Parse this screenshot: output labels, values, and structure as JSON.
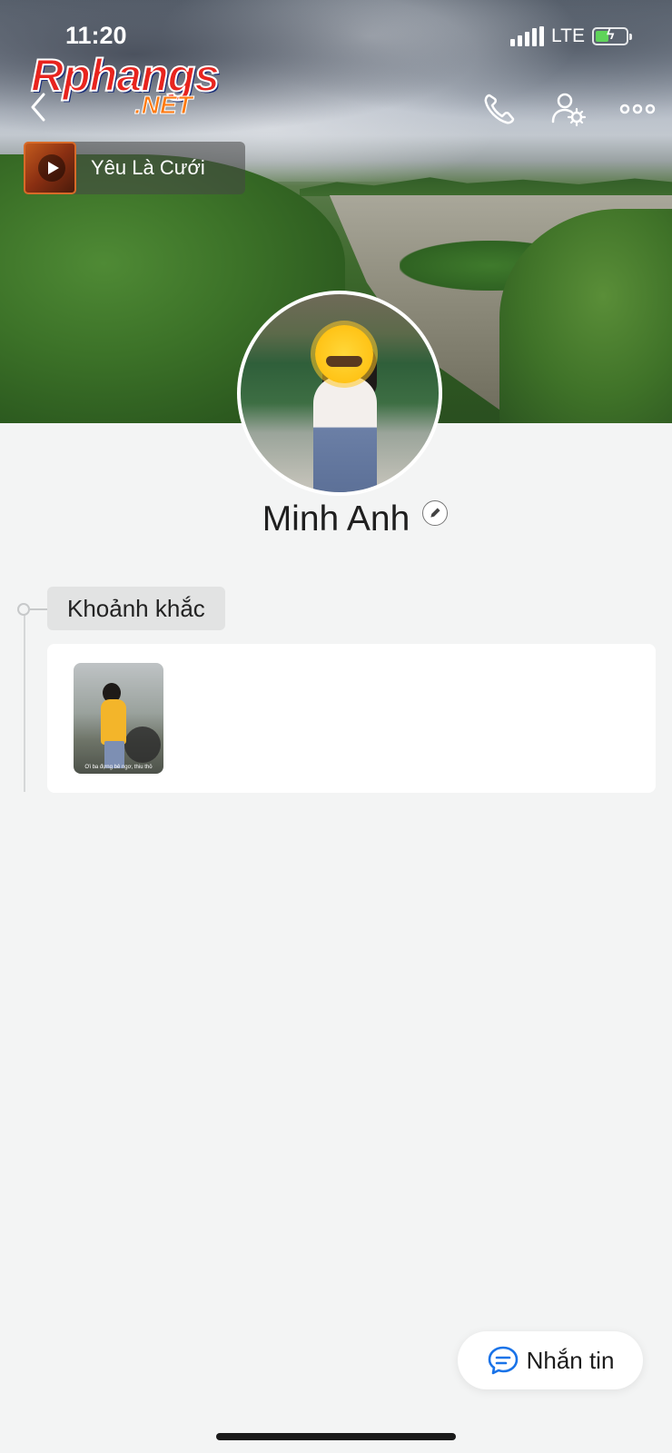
{
  "status_bar": {
    "time": "11:20",
    "network": "LTE",
    "battery_charging": true
  },
  "watermark": {
    "line1": "Rphangs",
    "line2": ".NET"
  },
  "header": {
    "back_icon": "chevron-left-icon",
    "actions": [
      "phone-icon",
      "user-settings-icon",
      "more-icon"
    ]
  },
  "music": {
    "title": "Yêu Là Cưới",
    "icon": "play-icon"
  },
  "profile": {
    "name": "Minh Anh",
    "edit_icon": "pencil-icon"
  },
  "moments": {
    "label": "Khoảnh khắc",
    "caption": "Ơi ba đựng bẻ ngơ, thiu thỏ"
  },
  "message_button": {
    "label": "Nhắn tin",
    "icon": "chat-icon"
  },
  "colors": {
    "accent": "#1a73e8",
    "background": "#f3f4f4"
  }
}
